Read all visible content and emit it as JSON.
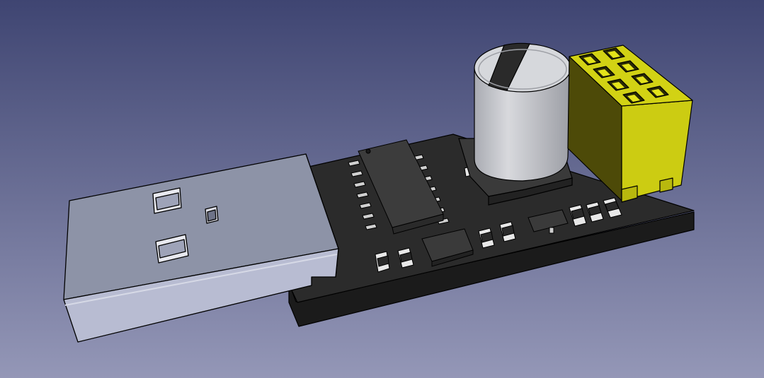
{
  "scene": {
    "background": {
      "top": "#3f4572",
      "bottom": "#9497b7"
    },
    "colors": {
      "pcb_top": "#2a2a2a",
      "pcb_side": "#1c1c1c",
      "usb_top": "#8e94a8",
      "usb_front": "#b9bdd3",
      "usb_side": "#a1a6bd",
      "cap_body": "#c4c6cb",
      "cap_top": "#d4d6da",
      "cap_stripe": "#2a2a2a",
      "header_yellow": "#cccc0f",
      "header_dark": "#4d4a08",
      "ic_body": "#3d3d3d",
      "pin_metal": "#c8c8c8",
      "smd_body": "#e6e6e6",
      "outline": "#000000"
    },
    "components": [
      {
        "name": "usb-plug"
      },
      {
        "name": "pcb-board"
      },
      {
        "name": "soic-16-ic"
      },
      {
        "name": "electrolytic-capacitor"
      },
      {
        "name": "pin-header-2x4"
      },
      {
        "name": "crystal-package"
      },
      {
        "name": "sot23-transistor"
      },
      {
        "name": "smd-resistors"
      }
    ]
  }
}
